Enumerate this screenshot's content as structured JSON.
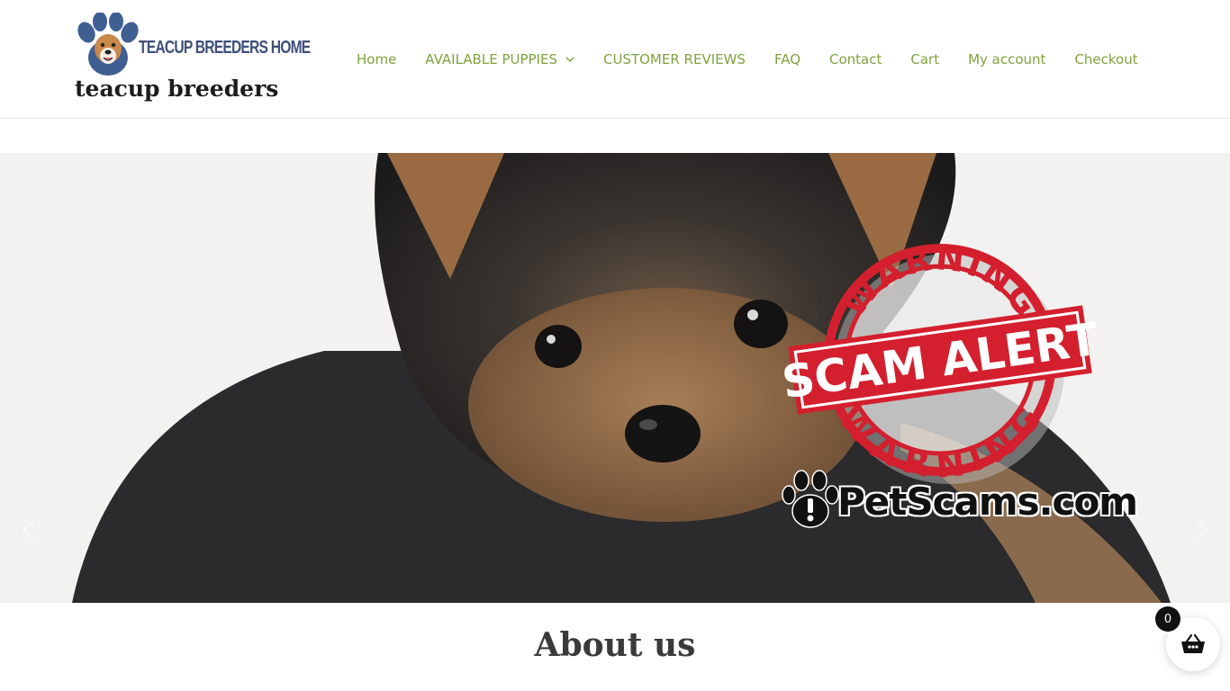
{
  "brand": {
    "logo_text": "TEACUP BREEDERS HOME",
    "site_title": "teacup breeders",
    "accent_color": "#7ea33e"
  },
  "nav": {
    "items": [
      {
        "label": "Home"
      },
      {
        "label": "AVAILABLE PUPPIES",
        "has_dropdown": true
      },
      {
        "label": "CUSTOMER REVIEWS"
      },
      {
        "label": "FAQ"
      },
      {
        "label": "Contact"
      },
      {
        "label": "Cart"
      },
      {
        "label": "My account"
      },
      {
        "label": "Checkout"
      }
    ]
  },
  "hero": {
    "stamp_top": "WARNING",
    "stamp_middle": "SCAM ALERT",
    "stamp_bottom": "WARNING",
    "watermark": "PetScams.com",
    "stamp_color": "#d31f2e",
    "prev_icon": "chevron-left-icon",
    "next_icon": "chevron-right-icon"
  },
  "about": {
    "title": "About us"
  },
  "cart": {
    "count": "0",
    "icon": "basket-icon"
  }
}
